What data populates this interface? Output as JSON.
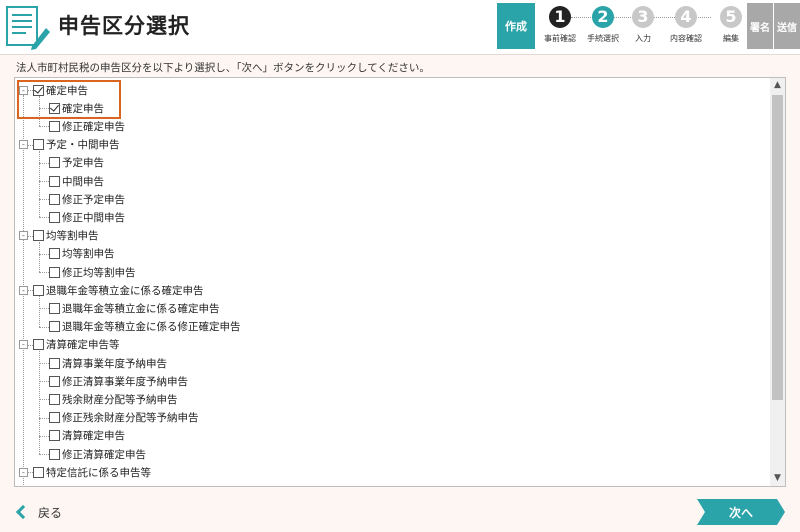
{
  "header": {
    "title": "申告区分選択",
    "steps": {
      "create_label": "作成",
      "items": [
        {
          "number": "1",
          "label": "事前確認",
          "state": "done"
        },
        {
          "number": "2",
          "label": "手続選択",
          "state": "current"
        },
        {
          "number": "3",
          "label": "入力",
          "state": "todo"
        },
        {
          "number": "4",
          "label": "内容確認",
          "state": "todo"
        },
        {
          "number": "5",
          "label": "編集",
          "state": "todo"
        }
      ],
      "sign_label": "署名",
      "send_label": "送信"
    }
  },
  "instruction": "法人市町村民税の申告区分を以下より選択し、「次へ」ボタンをクリックしてください。",
  "tree": [
    {
      "label": "確定申告",
      "checked": true,
      "children": [
        {
          "label": "確定申告",
          "checked": true
        },
        {
          "label": "修正確定申告",
          "checked": false
        }
      ]
    },
    {
      "label": "予定・中間申告",
      "checked": false,
      "children": [
        {
          "label": "予定申告",
          "checked": false
        },
        {
          "label": "中間申告",
          "checked": false
        },
        {
          "label": "修正予定申告",
          "checked": false
        },
        {
          "label": "修正中間申告",
          "checked": false
        }
      ]
    },
    {
      "label": "均等割申告",
      "checked": false,
      "children": [
        {
          "label": "均等割申告",
          "checked": false
        },
        {
          "label": "修正均等割申告",
          "checked": false
        }
      ]
    },
    {
      "label": "退職年金等積立金に係る確定申告",
      "checked": false,
      "children": [
        {
          "label": "退職年金等積立金に係る確定申告",
          "checked": false
        },
        {
          "label": "退職年金等積立金に係る修正確定申告",
          "checked": false
        }
      ]
    },
    {
      "label": "清算確定申告等",
      "checked": false,
      "children": [
        {
          "label": "清算事業年度予納申告",
          "checked": false
        },
        {
          "label": "修正清算事業年度予納申告",
          "checked": false
        },
        {
          "label": "残余財産分配等予納申告",
          "checked": false
        },
        {
          "label": "修正残余財産分配等予納申告",
          "checked": false
        },
        {
          "label": "清算確定申告",
          "checked": false
        },
        {
          "label": "修正清算確定申告",
          "checked": false
        }
      ]
    },
    {
      "label": "特定信託に係る申告等",
      "checked": false,
      "children": []
    }
  ],
  "footer": {
    "back_label": "戻る",
    "next_label": "次へ"
  },
  "colors": {
    "accent": "#2aa3a9",
    "highlight": "#d9651f"
  }
}
